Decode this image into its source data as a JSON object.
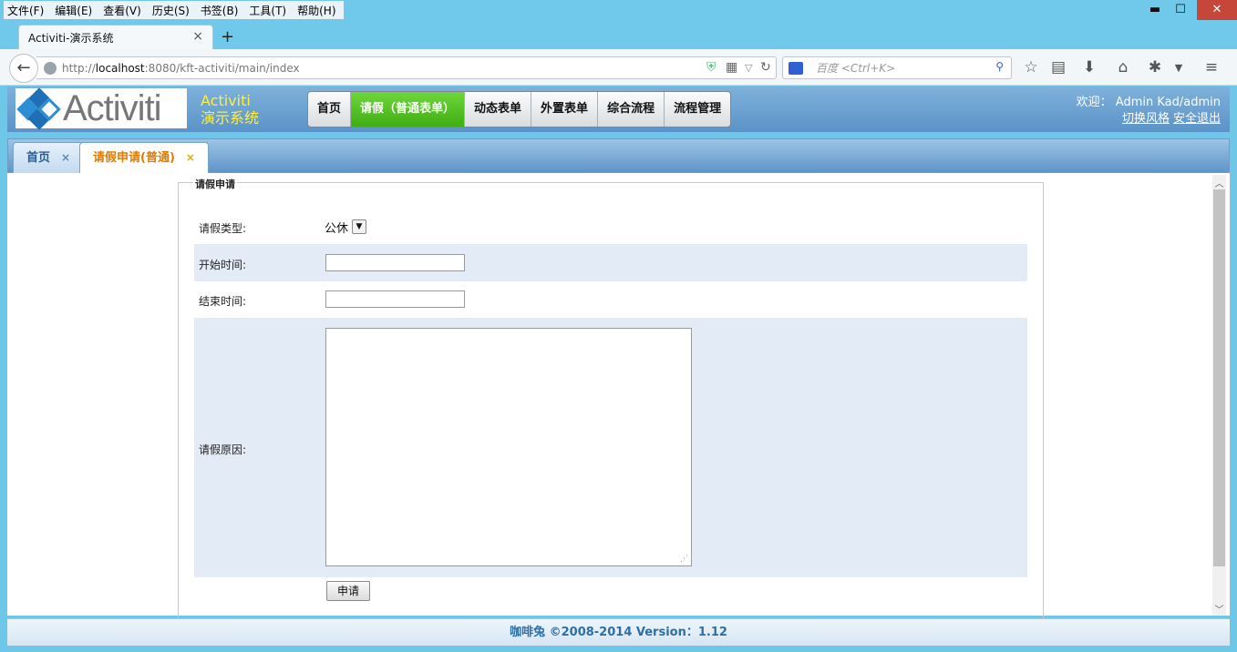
{
  "browser": {
    "menu": [
      "文件(F)",
      "编辑(E)",
      "查看(V)",
      "历史(S)",
      "书签(B)",
      "工具(T)",
      "帮助(H)"
    ],
    "window_controls": {
      "minimize": "▬",
      "maximize": "☐",
      "close": "✕"
    },
    "tab_title": "Activiti-演示系统",
    "tab_close": "×",
    "new_tab": "+",
    "url_prefix": "http://",
    "url_host": "localhost",
    "url_rest": ":8080/kft-activiti/main/index",
    "search_placeholder": "百度 <Ctrl+K>"
  },
  "app": {
    "logo_text": "Activiti",
    "system_name_line1": "Activiti",
    "system_name_line2": "演示系统",
    "nav": [
      "首页",
      "请假（普通表单）",
      "动态表单",
      "外置表单",
      "综合流程",
      "流程管理"
    ],
    "nav_active_index": 1,
    "welcome": "欢迎： Admin Kad/admin",
    "switch_style": "切换风格",
    "logout": "安全退出"
  },
  "page_tabs": [
    {
      "label": "首页",
      "close": "×"
    },
    {
      "label": "请假申请(普通)",
      "close": "×"
    }
  ],
  "form": {
    "legend": "请假申请",
    "type_label": "请假类型:",
    "type_value": "公休",
    "start_label": "开始时间:",
    "start_value": "",
    "end_label": "结束时间:",
    "end_value": "",
    "reason_label": "请假原因:",
    "reason_value": "",
    "submit_label": "申请"
  },
  "footer": "咖啡兔 ©2008-2014 Version：1.12",
  "colors": {
    "chrome": "#70c9ea",
    "nav_active": "#4cbf1e",
    "system_name": "#ffef3c",
    "active_tab_text": "#e07b00",
    "row_alt": "#e3ebf7",
    "footer_text": "#2d6fa5"
  }
}
